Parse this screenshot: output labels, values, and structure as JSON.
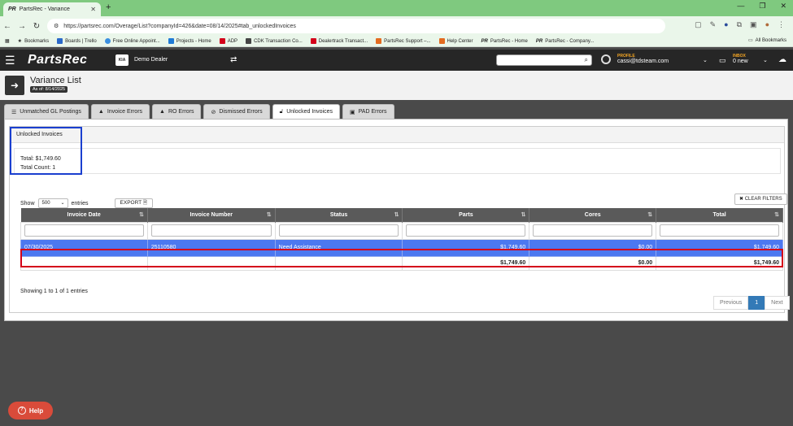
{
  "browser": {
    "tab_title": "PartsRec - Variance",
    "url": "https://partsrec.com/Overage/List?companyId=426&date=08/14/2025#tab_unlockedInvoices",
    "bookmarks": [
      "Bookmarks",
      "Boards | Trello",
      "Free Online Appoint...",
      "Projects - Home",
      "ADP",
      "CDK Transaction Co...",
      "Dealertrack Transact...",
      "PartsRec Support –...",
      "Help Center",
      "PartsRec - Home",
      "PartsRec - Company..."
    ],
    "all_bookmarks": "All Bookmarks"
  },
  "header": {
    "logo": "PartsRec",
    "dealer": "Demo Dealer",
    "profile_label": "PROFILE",
    "profile_email": "cassi@tdsteam.com",
    "inbox_label": "INBOX",
    "inbox_count": "0 new"
  },
  "page": {
    "title": "Variance List",
    "as_of": "As of: 8/14/2025"
  },
  "tabs": [
    {
      "label": "Unmatched GL Postings",
      "icon": "list-icon"
    },
    {
      "label": "Invoice Errors",
      "icon": "warning-icon"
    },
    {
      "label": "RO Errors",
      "icon": "warning-icon"
    },
    {
      "label": "Dismissed Errors",
      "icon": "dismissed-icon"
    },
    {
      "label": "Unlocked Invoices",
      "icon": "unlock-icon"
    },
    {
      "label": "PAD Errors",
      "icon": "pad-icon"
    }
  ],
  "summary": {
    "heading": "Unlocked Invoices",
    "total": "Total: $1,749.60",
    "count": "Total Count: 1"
  },
  "controls": {
    "show": "Show",
    "page_size": "500",
    "entries": "entries",
    "export": "EXPORT",
    "clear_filters": "CLEAR FILTERS"
  },
  "table": {
    "columns": [
      "Invoice Date",
      "Invoice Number",
      "Status",
      "Parts",
      "Cores",
      "Total"
    ],
    "rows": [
      {
        "date": "07/30/2025",
        "number": "25110580",
        "status": "Need Assistance",
        "parts": "$1,749.60",
        "cores": "$0.00",
        "total": "$1,749.60"
      }
    ],
    "totals": {
      "parts": "$1,749.60",
      "cores": "$0.00",
      "total": "$1,749.60"
    }
  },
  "footer": {
    "showing": "Showing 1 to 1 of 1 entries",
    "previous": "Previous",
    "page": "1",
    "next": "Next"
  },
  "help": "Help",
  "colors": {
    "selected_row": "#4c78f0",
    "highlight_red": "#d4001a",
    "highlight_blue": "#1a3fcf",
    "browser_green": "#7fc97f"
  }
}
